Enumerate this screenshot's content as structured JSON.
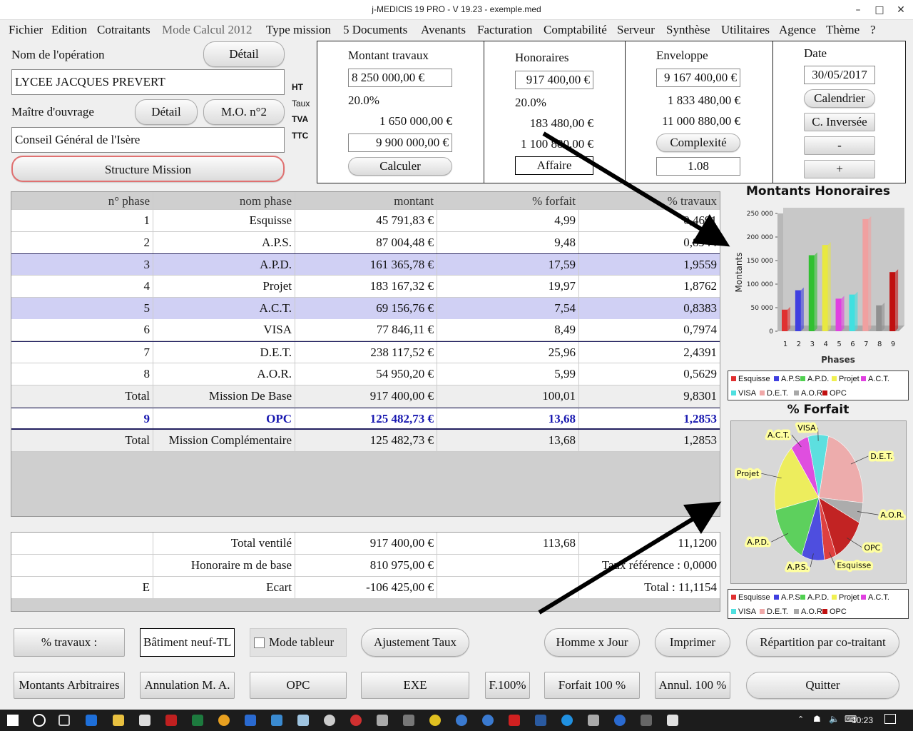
{
  "window": {
    "title": "j-MEDICIS 19 PRO - V 19.23 - exemple.med"
  },
  "menu": [
    "Fichier",
    "Edition",
    "Cotraitants",
    "Mode Calcul 2012",
    "Type mission",
    "5 Documents",
    "Avenants",
    "Facturation",
    "Comptabilité",
    "Serveur",
    "Synthèse",
    "Utilitaires",
    "Agence",
    "Thème",
    "?"
  ],
  "operation": {
    "label": "Nom de l'opération",
    "detail_btn": "Détail",
    "value": "LYCEE JACQUES PREVERT",
    "mo_label": "Maître d'ouvrage",
    "mo_detail_btn": "Détail",
    "mo2_btn": "M.O. n°2",
    "mo_value": "Conseil Général de l'Isère",
    "structure_btn": "Structure Mission"
  },
  "side_labels": {
    "ht": "HT",
    "taux": "Taux",
    "tva": "TVA",
    "ttc": "TTC"
  },
  "travaux": {
    "title": "Montant travaux",
    "ht": "8 250 000,00 €",
    "taux": "20.0%",
    "tva": "1 650 000,00 €",
    "ttc": "9 900 000,00 €",
    "calc_btn": "Calculer"
  },
  "honoraires": {
    "title": "Honoraires",
    "ht": "917 400,00 €",
    "taux": "20.0%",
    "tva": "183 480,00 €",
    "ttc": "1 100 880,00 €",
    "affaire_btn": "Affaire"
  },
  "enveloppe": {
    "title": "Enveloppe",
    "ht": "9 167 400,00 €",
    "tva": "1 833 480,00 €",
    "ttc": "11 000 880,00 €",
    "complexite_btn": "Complexité",
    "complexite": "1.08"
  },
  "date": {
    "title": "Date",
    "value": "30/05/2017",
    "cal_btn": "Calendrier",
    "inv_btn": "C. Inversée",
    "minus": "-",
    "plus": "+"
  },
  "table": {
    "headers": [
      "n° phase",
      "nom phase",
      "montant",
      "% forfait",
      "% travaux"
    ],
    "rows": [
      {
        "n": "1",
        "nom": "Esquisse",
        "montant": "45 791,83 €",
        "forfait": "4,99",
        "travaux": "0,4691",
        "bg": "#ffffff"
      },
      {
        "n": "2",
        "nom": "A.P.S.",
        "montant": "87 004,48 €",
        "forfait": "9,48",
        "travaux": "0,8944",
        "bg": "#ffffff"
      },
      {
        "n": "3",
        "nom": "A.P.D.",
        "montant": "161 365,78 €",
        "forfait": "17,59",
        "travaux": "1,9559",
        "bg": "#d0d0f4"
      },
      {
        "n": "4",
        "nom": "Projet",
        "montant": "183 167,32 €",
        "forfait": "19,97",
        "travaux": "1,8762",
        "bg": "#ffffff"
      },
      {
        "n": "5",
        "nom": "A.C.T.",
        "montant": "69 156,76 €",
        "forfait": "7,54",
        "travaux": "0,8383",
        "bg": "#d0d0f4"
      },
      {
        "n": "6",
        "nom": "VISA",
        "montant": "77 846,11 €",
        "forfait": "8,49",
        "travaux": "0,7974",
        "bg": "#ffffff"
      },
      {
        "n": "7",
        "nom": "D.E.T.",
        "montant": "238 117,52 €",
        "forfait": "25,96",
        "travaux": "2,4391",
        "bg": "#ffffff"
      },
      {
        "n": "8",
        "nom": "A.O.R.",
        "montant": "54 950,20 €",
        "forfait": "5,99",
        "travaux": "0,5629",
        "bg": "#ffffff"
      },
      {
        "n": "Total",
        "nom": "Mission De Base",
        "montant": "917 400,00 €",
        "forfait": "100,01",
        "travaux": "9,8301",
        "bg": "#eeeeee"
      },
      {
        "n": "9",
        "nom": "OPC",
        "montant": "125 482,73 €",
        "forfait": "13,68",
        "travaux": "1,2853",
        "bg": "#ffffff",
        "bold": true
      },
      {
        "n": "Total",
        "nom": "Mission Complémentaire",
        "montant": "125 482,73 €",
        "forfait": "13,68",
        "travaux": "1,2853",
        "bg": "#eeeeee"
      }
    ]
  },
  "totals": {
    "rows": [
      {
        "a": "",
        "b": "Total ventilé",
        "c": "917 400,00 €",
        "d": "113,68",
        "e": "11,1200"
      },
      {
        "a": "",
        "b": "Honoraire m de base",
        "c": "810 975,00 €",
        "d": "",
        "e": "Taux référence : 0,0000"
      },
      {
        "a": "E",
        "b": "Ecart",
        "c": "-106 425,00 €",
        "d": "",
        "e": "Total : 11,1154"
      }
    ]
  },
  "bar_chart_title": "Montants Honoraires",
  "pie_chart_title": "% Forfait",
  "chart_data": [
    {
      "type": "bar",
      "title": "Montants Honoraires",
      "xlabel": "Phases",
      "ylabel": "Montants",
      "categories": [
        "1",
        "2",
        "3",
        "4",
        "5",
        "6",
        "7",
        "8",
        "9"
      ],
      "values": [
        45792,
        87004,
        161366,
        183167,
        69157,
        77846,
        238118,
        54950,
        125483
      ],
      "colors": [
        "#e03030",
        "#4040e0",
        "#30c030",
        "#e8e840",
        "#e040e0",
        "#40e0e0",
        "#f0a0a0",
        "#909090",
        "#c01010"
      ],
      "ylim": [
        0,
        250000
      ],
      "yticks": [
        "0",
        "50 000",
        "100 000",
        "150 000",
        "200 000",
        "250 000"
      ]
    },
    {
      "type": "pie",
      "title": "% Forfait",
      "labels": [
        "Esquisse",
        "A.P.S.",
        "A.P.D.",
        "Projet",
        "A.C.T.",
        "VISA",
        "D.E.T.",
        "A.O.R.",
        "OPC"
      ],
      "values": [
        4.99,
        9.48,
        17.59,
        19.97,
        7.54,
        8.49,
        25.96,
        5.99,
        13.68
      ],
      "colors": [
        "#e03030",
        "#4040e0",
        "#50d050",
        "#f0f050",
        "#e040e0",
        "#50e0e0",
        "#f0a8a8",
        "#a8a8a8",
        "#c01010"
      ]
    }
  ],
  "legend": [
    "Esquisse",
    "A.P.S.",
    "A.P.D.",
    "Projet",
    "A.C.T.",
    "VISA",
    "D.E.T.",
    "A.O.R.",
    "OPC"
  ],
  "bottom": {
    "pct_travaux_btn": "% travaux :",
    "batiment": "Bâtiment neuf-TL",
    "mode_tableur": "Mode tableur",
    "ajust_btn": "Ajustement Taux",
    "homme_btn": "Homme x Jour",
    "imprimer_btn": "Imprimer",
    "repartition_btn": "Répartition par co-traitant",
    "arbitraires_btn": "Montants Arbitraires",
    "annulation_btn": "Annulation M. A.",
    "opc_btn": "OPC",
    "exe_btn": "EXE",
    "f100_btn": "F.100%",
    "forfait_btn": "Forfait 100 %",
    "annul100_btn": "Annul. 100 %",
    "quitter_btn": "Quitter"
  },
  "taskbar": {
    "time": "10:23"
  }
}
